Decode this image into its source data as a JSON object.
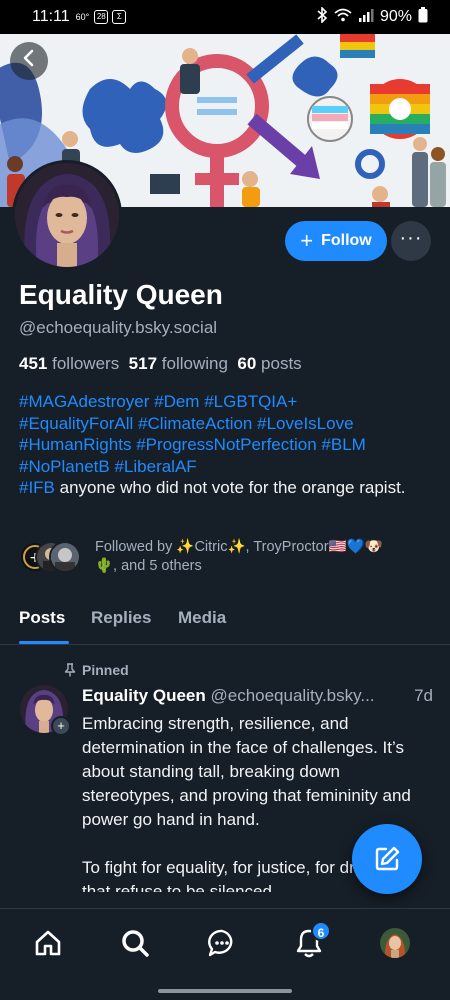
{
  "status_bar": {
    "time": "11:11",
    "temp": "60°",
    "date_badge": "28",
    "battery": "90%"
  },
  "profile": {
    "display_name": "Equality Queen",
    "handle": "@echoequality.bsky.social",
    "followers_count": "451",
    "followers_label": "followers",
    "following_count": "517",
    "following_label": "following",
    "posts_count": "60",
    "posts_label": "posts",
    "follow_label": "Follow",
    "bio": {
      "tags_line1": [
        "#MAGAdestroyer",
        "#Dem",
        "#LGBTQIA+"
      ],
      "tags_line2": [
        "#EqualityForAll",
        "#ClimateAction",
        "#LoveIsLove"
      ],
      "tags_line3": [
        "#HumanRights",
        "#ProgressNotPerfection",
        "#BLM"
      ],
      "tags_line4": [
        "#NoPlanetB",
        "#LiberalAF"
      ],
      "tag_last": "#IFB",
      "text_last": " anyone who did not vote for the orange rapist."
    },
    "followed_by_line1": "Followed by ✨Citric✨, TroyProctor🇺🇸💙🐶",
    "followed_by_line2": "🌵, and 5 others"
  },
  "tabs": [
    {
      "label": "Posts",
      "active": true
    },
    {
      "label": "Replies",
      "active": false
    },
    {
      "label": "Media",
      "active": false
    }
  ],
  "pinned_post": {
    "pinned_label": "Pinned",
    "author_name": "Equality Queen",
    "author_handle": "@echoequality.bsky...",
    "time": "7d",
    "paragraph1": "Embracing strength, resilience, and determination in the face of challenges. It’s about standing tall, breaking down stereotypes, and proving that femininity and power go hand in hand.",
    "paragraph2": "To fight for equality, for justice, for dreams that refuse to be silenced."
  },
  "bottom_nav": {
    "items": [
      "home-icon",
      "search-icon",
      "chat-icon",
      "bell-icon",
      "profile-avatar"
    ],
    "notification_count": "6"
  },
  "colors": {
    "accent": "#208bfe",
    "background": "#161e27",
    "muted_text": "#a4b0bd"
  }
}
